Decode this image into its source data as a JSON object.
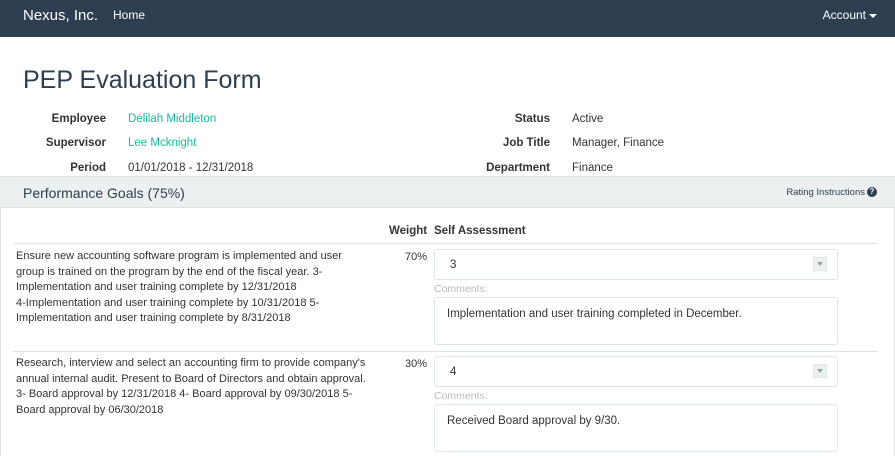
{
  "navbar": {
    "brand": "Nexus, Inc.",
    "home": "Home",
    "account": "Account"
  },
  "page": {
    "title": "PEP Evaluation Form"
  },
  "info": {
    "left": [
      {
        "label": "Employee",
        "value": "Delilah Middleton"
      },
      {
        "label": "Supervisor",
        "value": "Lee Mcknight"
      },
      {
        "label": "Period",
        "value": "01/01/2018 - 12/31/2018"
      }
    ],
    "right": [
      {
        "label": "Status",
        "value": "Active"
      },
      {
        "label": "Job Title",
        "value": "Manager, Finance"
      },
      {
        "label": "Department",
        "value": "Finance"
      }
    ]
  },
  "panel": {
    "title": "Performance Goals (75%)",
    "rating_instructions": "Rating Instructions",
    "col_weight": "Weight",
    "col_self_assessment": "Self Assessment"
  },
  "goals": [
    {
      "lines": [
        "Ensure new accounting software program is implemented and user",
        "group is trained on the program by the end of the fiscal year. 3-",
        "Implementation and user training complete by 12/31/2018",
        "4-Implementation and user training complete by 10/31/2018 5-",
        "Implementation and user training complete by 8/31/2018"
      ],
      "weight": "70%",
      "rating": "3",
      "comments_label": "Comments:",
      "comment": "Implementation and user training completed in December."
    },
    {
      "lines": [
        "Research, interview and select an accounting firm to provide company's",
        "annual internal audit. Present to Board of Directors and obtain approval.",
        "3- Board approval by 12/31/2018 4- Board approval by 09/30/2018 5-",
        "Board approval by 06/30/2018"
      ],
      "weight": "30%",
      "rating": "4",
      "comments_label": "Comments:",
      "comment": "Received Board approval by 9/30."
    }
  ]
}
